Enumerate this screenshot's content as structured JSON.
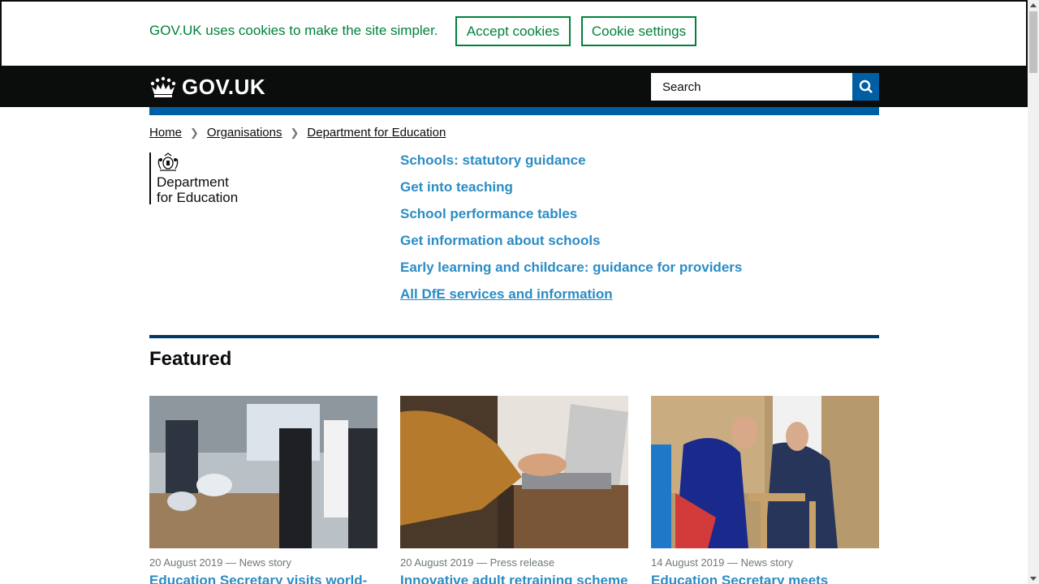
{
  "cookie_banner": {
    "message": "GOV.UK uses cookies to make the site simpler.",
    "accept_label": "Accept cookies",
    "settings_label": "Cookie settings"
  },
  "header": {
    "logo_text": "GOV.UK",
    "search_placeholder": "Search"
  },
  "breadcrumb": [
    "Home",
    "Organisations",
    "Department for Education"
  ],
  "organisation": {
    "line1": "Department",
    "line2": "for Education"
  },
  "quick_links": [
    "Schools: statutory guidance",
    "Get into teaching",
    "School performance tables",
    "Get information about schools",
    "Early learning and childcare: guidance for providers",
    "All DfE services and information"
  ],
  "featured": {
    "title": "Featured",
    "cards": [
      {
        "meta": "20 August 2019 — News story",
        "title": "Education Secretary visits world-"
      },
      {
        "meta": "20 August 2019 — Press release",
        "title": "Innovative adult retraining scheme"
      },
      {
        "meta": "14 August 2019 — News story",
        "title": "Education Secretary meets"
      }
    ]
  },
  "colors": {
    "cookie_green": "#00823b",
    "header_black": "#0b0c0c",
    "brand_blue": "#005ea5",
    "link_blue": "#2b8cc4"
  }
}
